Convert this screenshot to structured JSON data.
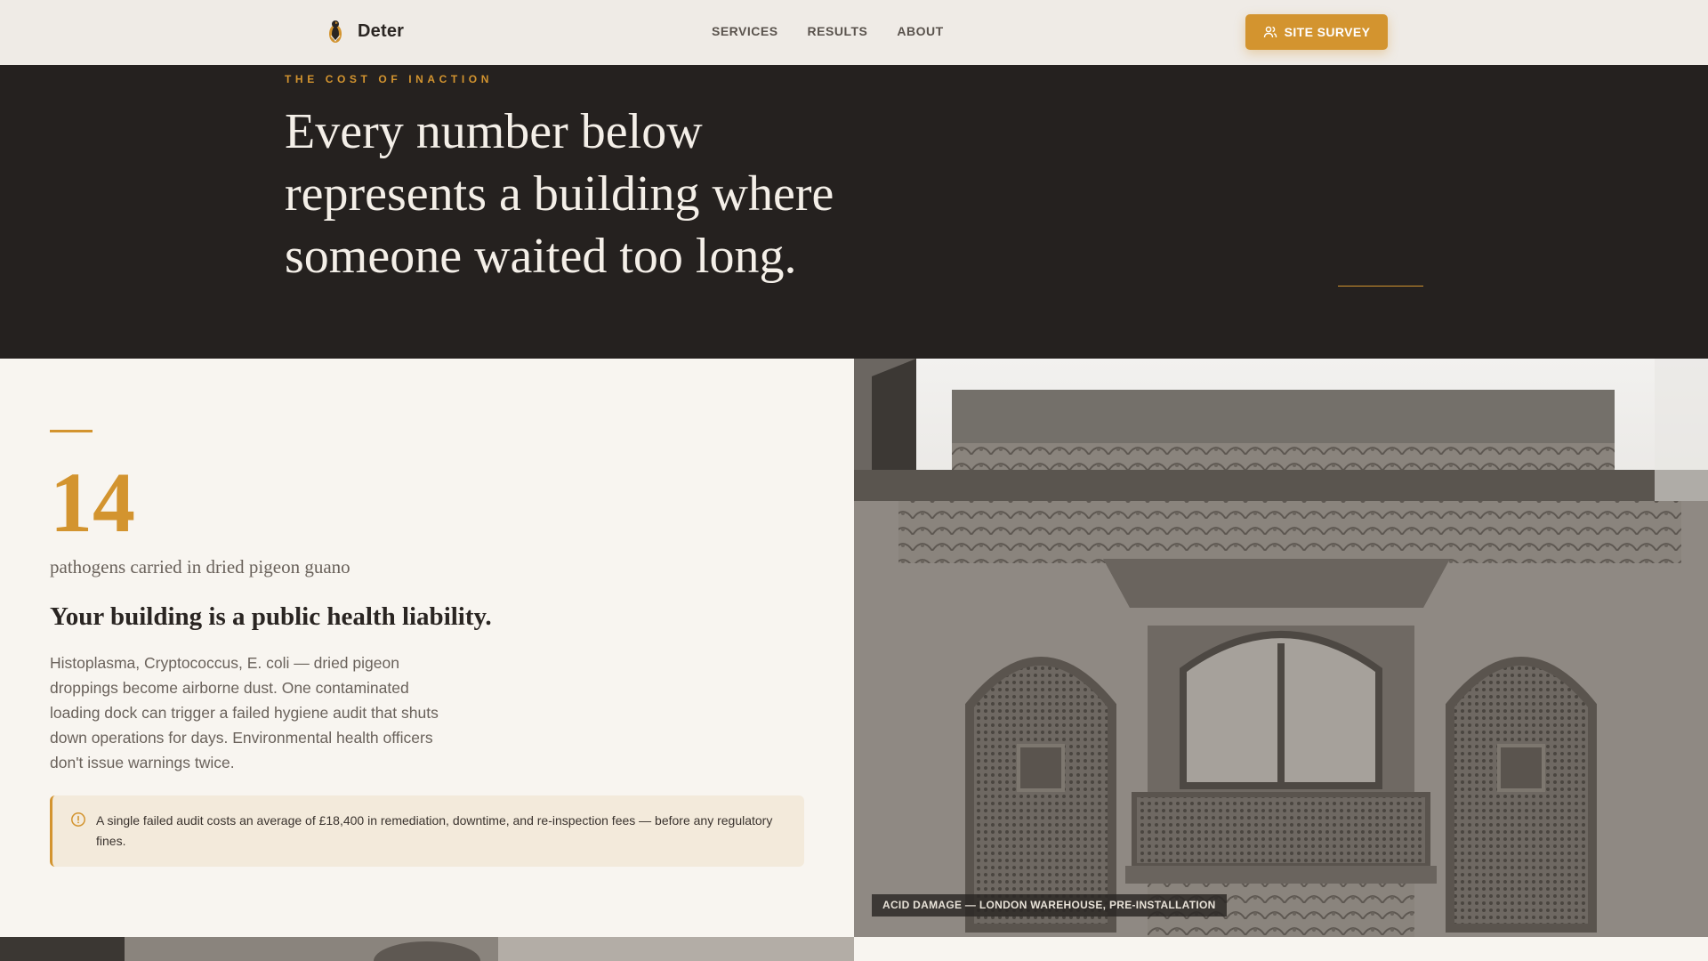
{
  "nav": {
    "brand": "Deter",
    "links": [
      "SERVICES",
      "RESULTS",
      "ABOUT"
    ],
    "cta_label": "SITE SURVEY",
    "cta_icon": "users-icon"
  },
  "hero": {
    "eyebrow": "THE COST OF INACTION",
    "title": "Every number below represents a building where someone waited too long."
  },
  "stat": {
    "number": "14",
    "caption": "pathogens carried in dried pigeon guano",
    "heading": "Your building is a public health liability.",
    "body": "Histoplasma, Cryptococcus, E. coli — dried pigeon droppings become airborne dust. One contaminated loading dock can trigger a failed hygiene audit that shuts down operations for days. Environmental health officers don't issue warnings twice.",
    "callout_icon": "alert-circle-icon",
    "callout": "A single failed audit costs an average of £18,400 in remediation, downtime, and re-inspection fees — before any regulatory fines."
  },
  "photo": {
    "caption": "ACID DAMAGE — LONDON WAREHOUSE, PRE-INSTALLATION"
  },
  "colors": {
    "accent": "#d3942f",
    "dark": "#25211f",
    "cream": "#f8f5f0"
  }
}
